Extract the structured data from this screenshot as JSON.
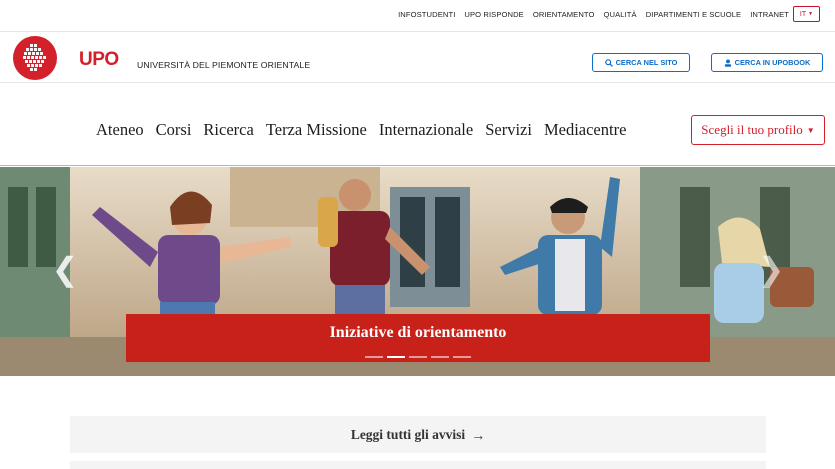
{
  "topbar": {
    "links": [
      "INFOSTUDENTI",
      "UPO RISPONDE",
      "ORIENTAMENTO",
      "QUALITÀ",
      "DIPARTIMENTI E SCUOLE",
      "INTRANET"
    ],
    "language": "IT"
  },
  "header": {
    "logo_word": "UPO",
    "logo_subtitle": "UNIVERSITÀ DEL PIEMONTE ORIENTALE",
    "search_button": "CERCA NEL SITO",
    "upobook_button": "CERCA IN UPOBOOK"
  },
  "nav": {
    "items": [
      "Ateneo",
      "Corsi",
      "Ricerca",
      "Terza Missione",
      "Internazionale",
      "Servizi",
      "Mediacentre"
    ],
    "profile_button": "Scegli il tuo profilo"
  },
  "hero": {
    "caption": "Iniziative di orientamento",
    "slide_count": 5,
    "active_slide": 2
  },
  "notices": {
    "label": "Leggi tutti gli avvisi",
    "arrow": "→"
  },
  "colors": {
    "brand_red": "#d3202b",
    "caption_red": "#c8211a",
    "link_blue": "#0b6ec7"
  }
}
